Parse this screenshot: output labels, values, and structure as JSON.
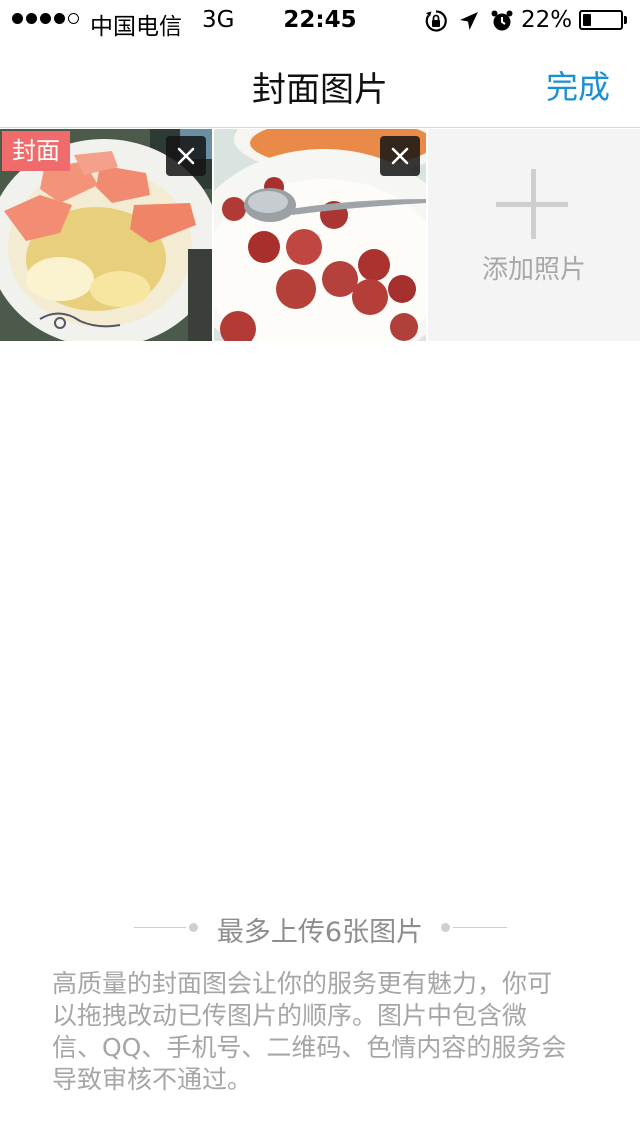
{
  "status_bar": {
    "carrier": "中国电信",
    "network": "3G",
    "time": "22:45",
    "battery_percent_text": "22%",
    "battery_level": 0.22,
    "signal_bars_filled": 4,
    "signal_bars_total": 5,
    "icons": [
      "orientation-lock-icon",
      "location-arrow-icon",
      "alarm-icon",
      "battery-icon"
    ]
  },
  "nav": {
    "title": "封面图片",
    "done_label": "完成"
  },
  "photos": {
    "cover_badge": "封面",
    "items": [
      {
        "subject": "food photo: rice with sliced ham",
        "is_cover": true
      },
      {
        "subject": "food photo: rice with chinese sausage and spoon",
        "is_cover": false
      }
    ],
    "add_label": "添加照片",
    "remove_icon": "close-icon",
    "add_icon": "plus-icon"
  },
  "footer": {
    "limit_text": "最多上传6张图片",
    "hint_lines": [
      "高质量的封面图会让你的服务更有魅力，你可",
      "以拖拽改动已传图片的顺序。图片中包含微",
      "信、QQ、手机号、二维码、色情内容的服务会",
      "导致审核不通过。"
    ]
  },
  "colors": {
    "accent": "#1a8fd6",
    "cover_badge_bg": "#f06b6b",
    "hint_text": "#a6a6a6",
    "add_tile_bg": "#f4f4f4"
  }
}
